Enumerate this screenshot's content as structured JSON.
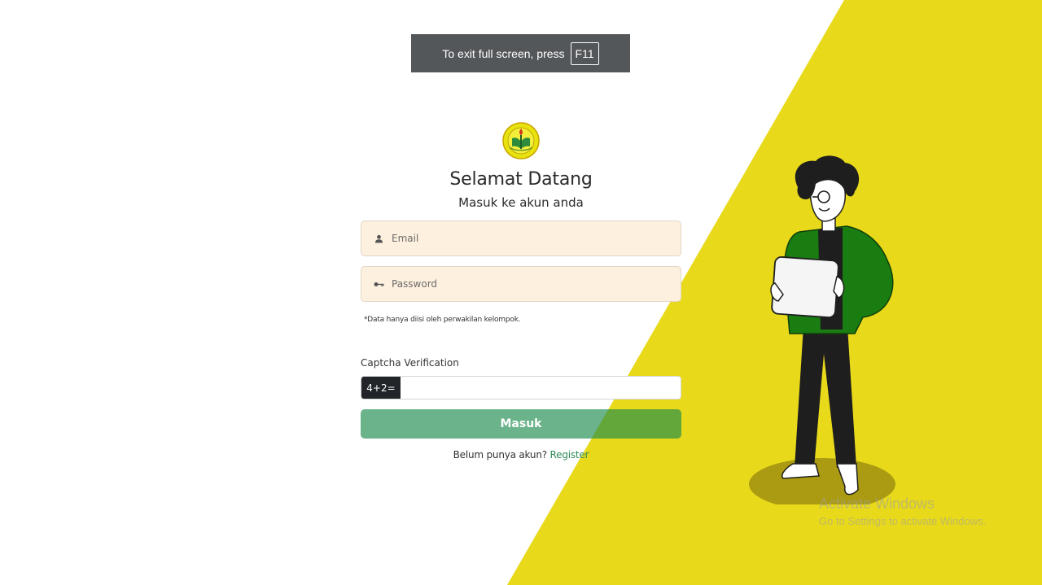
{
  "fullscreen_toast": {
    "text": "To exit full screen, press",
    "key": "F11"
  },
  "login": {
    "logo_icon": "university-emblem-icon",
    "title": "Selamat Datang",
    "subtitle": "Masuk ke akun anda",
    "email_placeholder": "Email",
    "password_placeholder": "Password",
    "note": "*Data hanya diisi oleh perwakilan kelompok.",
    "captcha_label": "Captcha Verification",
    "captcha_question": "4+2=",
    "submit_label": "Masuk",
    "register_prompt": "Belum punya akun?",
    "register_link": "Register"
  },
  "watermark": {
    "line1": "Activate Windows",
    "line2": "Go to Settings to activate Windows."
  },
  "colors": {
    "accent_yellow": "#e8d91a",
    "field_bg": "#fef0de",
    "button_green": "#1c8a4c",
    "link_green": "#2e8b57"
  }
}
